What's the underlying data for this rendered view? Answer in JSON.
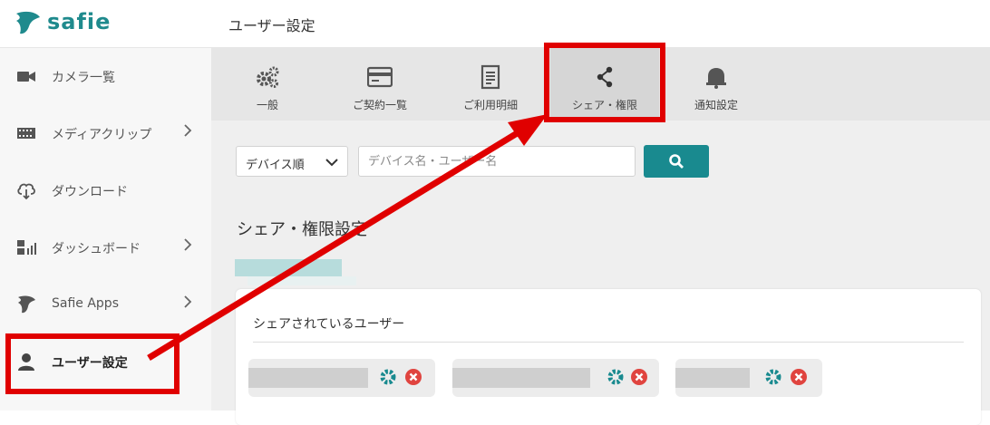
{
  "brand": {
    "logo_text": "safie",
    "color": "#1f8a8d"
  },
  "header": {
    "title": "ユーザー設定"
  },
  "sidebar": {
    "items": [
      {
        "label": "カメラ一覧",
        "icon": "camera-icon",
        "has_chevron": false
      },
      {
        "label": "メディアクリップ",
        "icon": "film-icon",
        "has_chevron": true
      },
      {
        "label": "ダウンロード",
        "icon": "cloud-download-icon",
        "has_chevron": false
      },
      {
        "label": "ダッシュボード",
        "icon": "dashboard-icon",
        "has_chevron": true
      },
      {
        "label": "Safie Apps",
        "icon": "safie-leaf-icon",
        "has_chevron": true
      },
      {
        "label": "ユーザー設定",
        "icon": "user-icon",
        "has_chevron": false,
        "active": true
      }
    ]
  },
  "tabs": [
    {
      "label": "一般",
      "icon": "gears-icon"
    },
    {
      "label": "ご契約一覧",
      "icon": "card-icon"
    },
    {
      "label": "ご利用明細",
      "icon": "document-icon"
    },
    {
      "label": "シェア・権限",
      "icon": "share-icon",
      "active": true
    },
    {
      "label": "通知設定",
      "icon": "bell-icon"
    }
  ],
  "filters": {
    "sort_value": "デバイス順",
    "search_placeholder": "デバイス名・ユーザー名"
  },
  "section": {
    "title": "シェア・権限設定"
  },
  "card": {
    "title": "シェアされているユーザー"
  },
  "colors": {
    "accent": "#198a8f",
    "delete": "#e0443f",
    "annotation": "#e00000"
  }
}
